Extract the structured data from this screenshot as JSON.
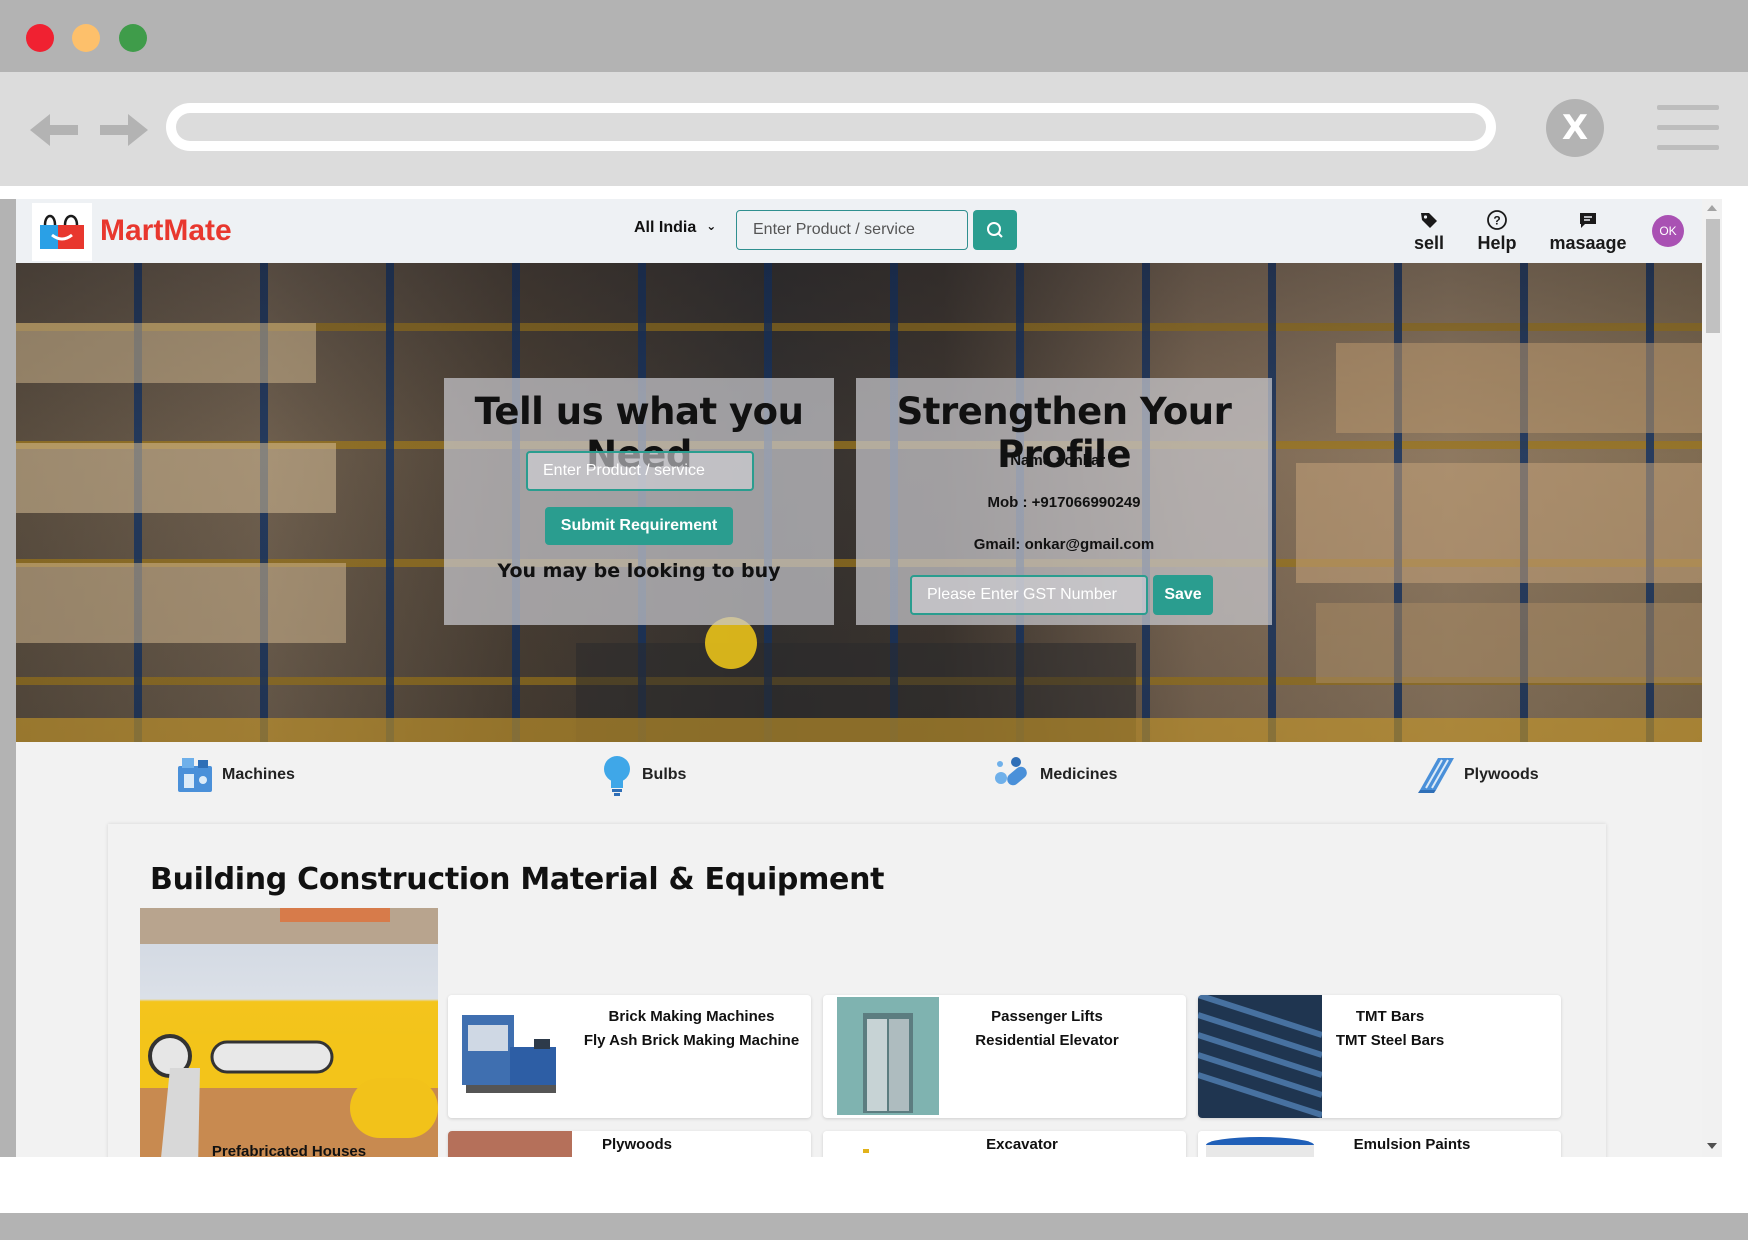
{
  "browser": {
    "close_label": "X"
  },
  "header": {
    "brand": "MartMate",
    "location": "All India",
    "search_placeholder": "Enter Product / service",
    "nav": [
      {
        "label": "sell",
        "icon": "tag-icon"
      },
      {
        "label": "Help",
        "icon": "help-circle-icon"
      },
      {
        "label": "masaage",
        "icon": "message-icon"
      }
    ],
    "avatar_initials": "OK"
  },
  "hero": {
    "need": {
      "title": "Tell us what you Need",
      "input_placeholder": "Enter Product / service",
      "submit_label": "Submit Requirement",
      "subtitle": "You may be looking to buy"
    },
    "profile": {
      "title": "Strengthen Your Profile",
      "name_line": "Name : onkar k",
      "mobile_line": "Mob : +917066990249",
      "gmail_line": "Gmail: onkar@gmail.com",
      "gst_placeholder": "Please Enter GST Number",
      "save_label": "Save"
    }
  },
  "categories": [
    {
      "label": "Machines",
      "icon": "machine-icon"
    },
    {
      "label": "Bulbs",
      "icon": "bulb-icon"
    },
    {
      "label": "Medicines",
      "icon": "pills-icon"
    },
    {
      "label": "Plywoods",
      "icon": "plywood-icon"
    }
  ],
  "section": {
    "title": "Building Construction Material & Equipment",
    "feature_label": "Prefabricated Houses",
    "products": [
      {
        "lines": [
          "Brick Making Machines",
          "Fly Ash Brick Making Machine"
        ]
      },
      {
        "lines": [
          "Passenger Lifts",
          "Residential Elevator"
        ]
      },
      {
        "lines": [
          "TMT Bars",
          "TMT Steel Bars"
        ]
      },
      {
        "lines": [
          "Plywoods"
        ]
      },
      {
        "lines": [
          "Excavator"
        ]
      },
      {
        "lines": [
          "Emulsion Paints"
        ]
      }
    ]
  },
  "colors": {
    "accent": "#2a9d8f",
    "brand": "#e8372e",
    "avatar": "#a951b3"
  }
}
